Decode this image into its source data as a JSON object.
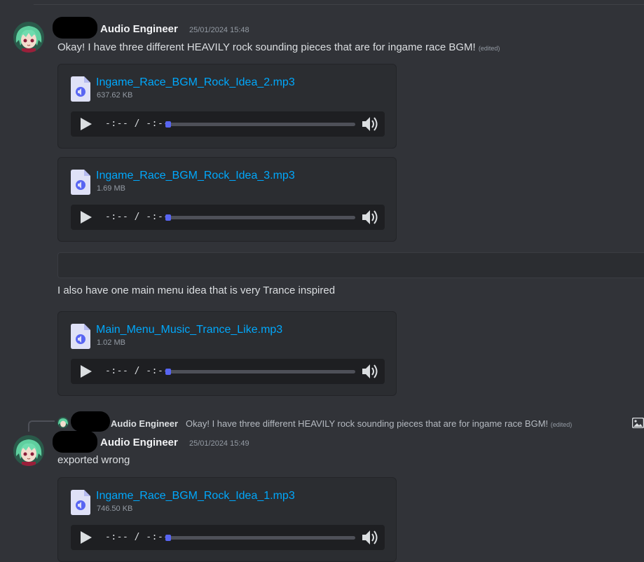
{
  "messages": [
    {
      "username": "Audio Engineer",
      "timestamp": "25/01/2024 15:48",
      "text": "Okay! I have three different HEAVILY rock sounding pieces that are for ingame race BGM!",
      "edited": "(edited)"
    },
    {
      "text": "I also have one main menu idea that is very Trance inspired"
    },
    {
      "username": "Audio Engineer",
      "timestamp": "25/01/2024 15:49",
      "text": "exported wrong"
    }
  ],
  "attachments": [
    {
      "filename": "Ingame_Race_BGM_Rock_Idea_2.mp3",
      "size": "637.62 KB",
      "time": "-:-- / -:--",
      "progress": 0
    },
    {
      "filename": "Ingame_Race_BGM_Rock_Idea_3.mp3",
      "size": "1.69 MB",
      "time": "-:-- / -:--",
      "progress": 0
    },
    {
      "filename": "Main_Menu_Music_Trance_Like.mp3",
      "size": "1.02 MB",
      "time": "-:-- / -:--",
      "progress": 0
    },
    {
      "filename": "Ingame_Race_BGM_Rock_Idea_1.mp3",
      "size": "746.50 KB",
      "time": "-:-- / -:--",
      "progress": 0
    }
  ],
  "reply": {
    "username": "Audio Engineer",
    "text": "Okay! I have three different HEAVILY rock sounding pieces that are for ingame race BGM!",
    "edited": "(edited)",
    "icon": "image-icon"
  },
  "colors": {
    "background": "#313338",
    "card": "#2b2d31",
    "player": "#1e1f22",
    "link": "#00a8fc",
    "accent": "#5865f2"
  }
}
